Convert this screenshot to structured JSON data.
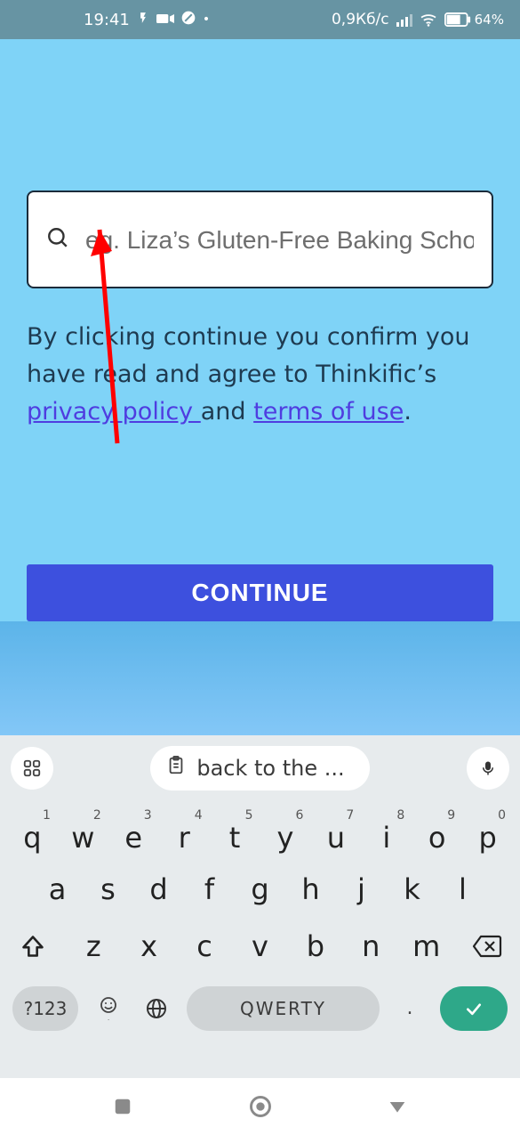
{
  "statusbar": {
    "time": "19:41",
    "data_rate": "0,9Кб/с",
    "battery_pct": "64",
    "battery_pct_suffix": "%"
  },
  "search": {
    "placeholder": "eg. Liza’s Gluten-Free Baking School",
    "value": ""
  },
  "disclaimer": {
    "prefix": "By clicking continue you confirm you have read and agree to Thinkific’s ",
    "privacy": "privacy policy ",
    "middle": "and ",
    "terms": "terms of use",
    "suffix": "."
  },
  "continue_label": "CONTINUE",
  "keyboard": {
    "suggestion": "back to the ...",
    "row1": [
      {
        "k": "q",
        "n": "1"
      },
      {
        "k": "w",
        "n": "2"
      },
      {
        "k": "e",
        "n": "3"
      },
      {
        "k": "r",
        "n": "4"
      },
      {
        "k": "t",
        "n": "5"
      },
      {
        "k": "y",
        "n": "6"
      },
      {
        "k": "u",
        "n": "7"
      },
      {
        "k": "i",
        "n": "8"
      },
      {
        "k": "o",
        "n": "9"
      },
      {
        "k": "p",
        "n": "0"
      }
    ],
    "row2": [
      "a",
      "s",
      "d",
      "f",
      "g",
      "h",
      "j",
      "k",
      "l"
    ],
    "row3": [
      "z",
      "x",
      "c",
      "v",
      "b",
      "n",
      "m"
    ],
    "symbols_label": "?123",
    "space_label": "QWERTY",
    "period": "."
  }
}
